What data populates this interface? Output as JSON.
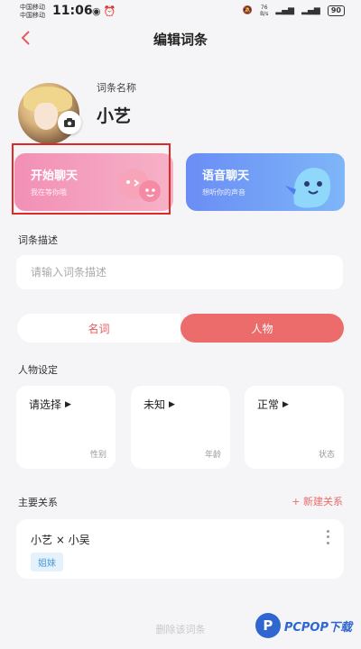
{
  "status_bar": {
    "carrier1": "中国移动",
    "carrier2": "中国移动",
    "time": "11:06",
    "speed_value": "76",
    "speed_unit": "B/s",
    "battery": "90"
  },
  "nav": {
    "title": "编辑词条",
    "back_icon": "chevron-left-icon"
  },
  "profile": {
    "name_label": "词条名称",
    "name": "小艺"
  },
  "cards": {
    "chat": {
      "title": "开始聊天",
      "subtitle": "我在等你哦"
    },
    "voice": {
      "title": "语音聊天",
      "subtitle": "想听你的声音"
    }
  },
  "description": {
    "label": "词条描述",
    "placeholder": "请输入词条描述",
    "value": ""
  },
  "segment": {
    "options": [
      "名词",
      "人物"
    ],
    "selected": "人物"
  },
  "settings": {
    "label": "人物设定",
    "items": [
      {
        "value": "请选择",
        "key": "性别"
      },
      {
        "value": "未知",
        "key": "年龄"
      },
      {
        "value": "正常",
        "key": "状态"
      }
    ]
  },
  "relations": {
    "label": "主要关系",
    "add_label": "+ 新建关系",
    "items": [
      {
        "names": "小艺 × 小吴",
        "tag": "姐妹"
      }
    ]
  },
  "delete_label": "删除该词条",
  "watermark": {
    "logo": "P",
    "text": "PCPOP下载"
  },
  "colors": {
    "accent": "#ec6b6b",
    "chat_card": "#f28fb5",
    "voice_card": "#6a8df5",
    "highlight": "#e02828"
  }
}
